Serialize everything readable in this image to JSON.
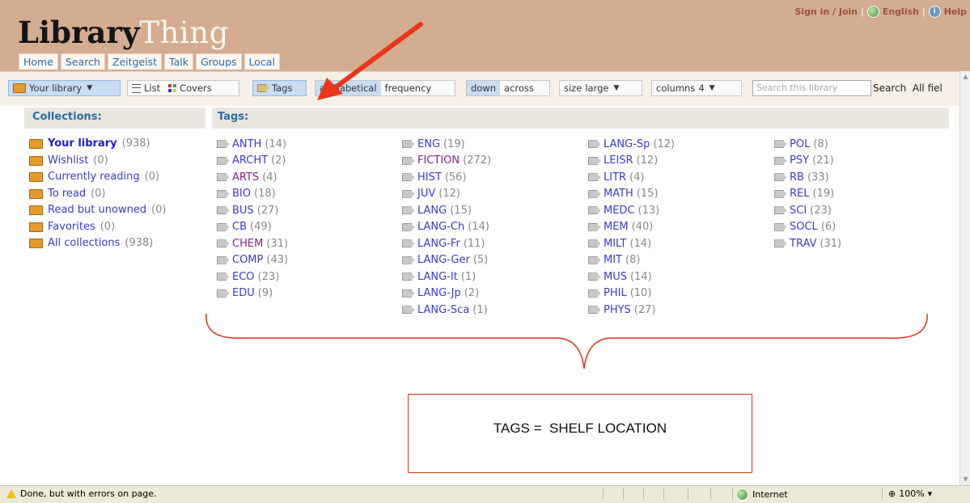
{
  "header": {
    "logo_part1": "Library",
    "logo_part2": "Thing",
    "nav": [
      "Home",
      "Search",
      "Zeitgeist",
      "Talk",
      "Groups",
      "Local"
    ],
    "signin": "Sign in / Join",
    "language": "English",
    "help": "Help"
  },
  "toolbar": {
    "library_dropdown": "Your library",
    "list": "List",
    "covers": "Covers",
    "tags": "Tags",
    "alphabetical": "alphabetical",
    "frequency": "frequency",
    "down": "down",
    "across": "across",
    "size_label": "size",
    "size_value": "large",
    "columns_label": "columns",
    "columns_value": "4",
    "search_placeholder": "Search this library",
    "search_button": "Search",
    "all_fields": "All fiel"
  },
  "collections": {
    "heading": "Collections:",
    "items": [
      {
        "label": "Your library",
        "count": "(938)"
      },
      {
        "label": "Wishlist",
        "count": "(0)"
      },
      {
        "label": "Currently reading",
        "count": "(0)"
      },
      {
        "label": "To read",
        "count": "(0)"
      },
      {
        "label": "Read but unowned",
        "count": "(0)"
      },
      {
        "label": "Favorites",
        "count": "(0)"
      },
      {
        "label": "All collections",
        "count": "(938)"
      }
    ]
  },
  "tags": {
    "heading": "Tags:",
    "columns": [
      [
        {
          "label": "ANTH",
          "count": "(14)"
        },
        {
          "label": "ARCHT",
          "count": "(2)"
        },
        {
          "label": "ARTS",
          "count": "(4)"
        },
        {
          "label": "BIO",
          "count": "(18)"
        },
        {
          "label": "BUS",
          "count": "(27)"
        },
        {
          "label": "CB",
          "count": "(49)"
        },
        {
          "label": "CHEM",
          "count": "(31)"
        },
        {
          "label": "COMP",
          "count": "(43)"
        },
        {
          "label": "ECO",
          "count": "(23)"
        },
        {
          "label": "EDU",
          "count": "(9)"
        }
      ],
      [
        {
          "label": "ENG",
          "count": "(19)"
        },
        {
          "label": "FICTION",
          "count": "(272)"
        },
        {
          "label": "HIST",
          "count": "(56)"
        },
        {
          "label": "JUV",
          "count": "(12)"
        },
        {
          "label": "LANG",
          "count": "(15)"
        },
        {
          "label": "LANG-Ch",
          "count": "(14)"
        },
        {
          "label": "LANG-Fr",
          "count": "(11)"
        },
        {
          "label": "LANG-Ger",
          "count": "(5)"
        },
        {
          "label": "LANG-It",
          "count": "(1)"
        },
        {
          "label": "LANG-Jp",
          "count": "(2)"
        },
        {
          "label": "LANG-Sca",
          "count": "(1)"
        }
      ],
      [
        {
          "label": "LANG-Sp",
          "count": "(12)"
        },
        {
          "label": "LEISR",
          "count": "(12)"
        },
        {
          "label": "LITR",
          "count": "(4)"
        },
        {
          "label": "MATH",
          "count": "(15)"
        },
        {
          "label": "MEDC",
          "count": "(13)"
        },
        {
          "label": "MEM",
          "count": "(40)"
        },
        {
          "label": "MILT",
          "count": "(14)"
        },
        {
          "label": "MIT",
          "count": "(8)"
        },
        {
          "label": "MUS",
          "count": "(14)"
        },
        {
          "label": "PHIL",
          "count": "(10)"
        },
        {
          "label": "PHYS",
          "count": "(27)"
        }
      ],
      [
        {
          "label": "POL",
          "count": "(8)"
        },
        {
          "label": "PSY",
          "count": "(21)"
        },
        {
          "label": "RB",
          "count": "(33)"
        },
        {
          "label": "REL",
          "count": "(19)"
        },
        {
          "label": "SCI",
          "count": "(23)"
        },
        {
          "label": "SOCL",
          "count": "(6)"
        },
        {
          "label": "TRAV",
          "count": "(31)"
        }
      ]
    ]
  },
  "annotation": {
    "note": "TAGS =  SHELF LOCATION",
    "color": "#d9341b"
  },
  "statusbar": {
    "message": "Done, but with errors on page.",
    "zone": "Internet",
    "zoom": "100%"
  }
}
